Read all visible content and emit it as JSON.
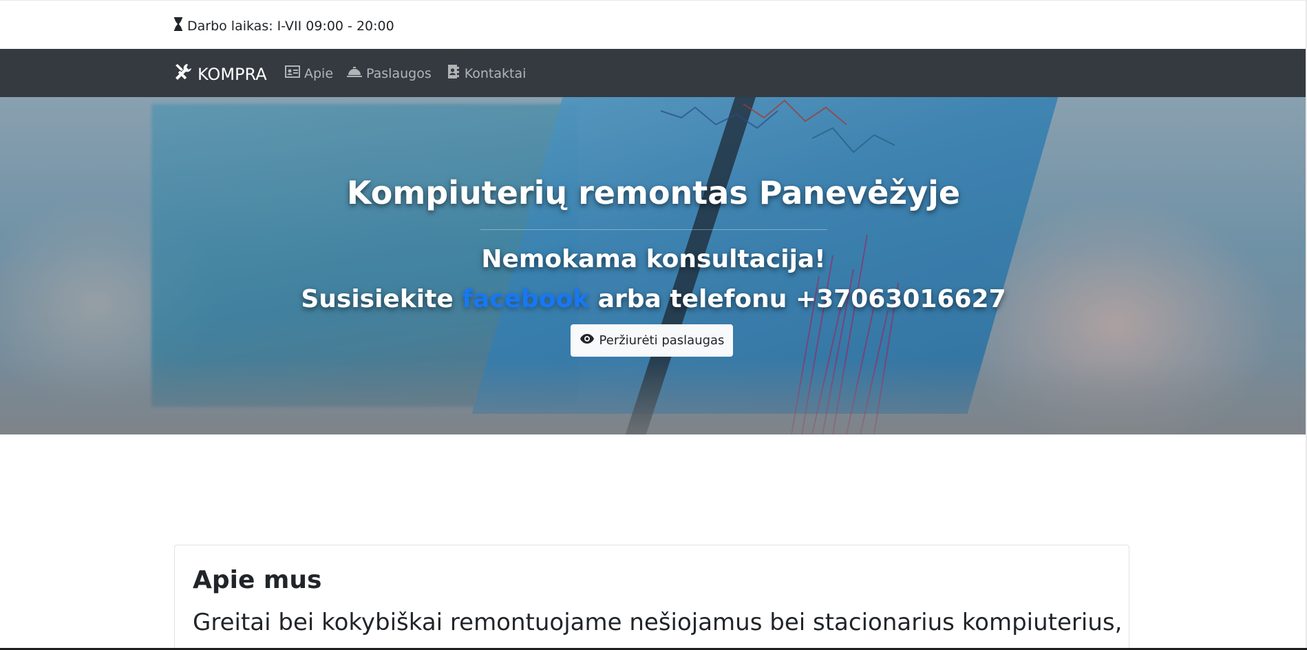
{
  "topbar": {
    "hours_icon": "hourglass-icon",
    "hours_text": "Darbo laikas: I-VII 09:00 - 20:00"
  },
  "navbar": {
    "brand": {
      "icon": "tools-icon",
      "label": "KOMPRA"
    },
    "links": [
      {
        "icon": "id-card-icon",
        "label": "Apie"
      },
      {
        "icon": "concierge-bell-icon",
        "label": "Paslaugos"
      },
      {
        "icon": "address-book-icon",
        "label": "Kontaktai"
      }
    ],
    "background_color": "#343a40"
  },
  "hero": {
    "title": "Kompiuterių remontas Panevėžyje",
    "subtitle": "Nemokama konsultacija!",
    "contact_prefix": "Susisiekite",
    "facebook_link": "facebook",
    "contact_suffix": "arba telefonu +37063016627",
    "button_icon": "eye-icon",
    "button_label": "Peržiurėti paslaugas",
    "facebook_color": "#1877f2"
  },
  "about": {
    "title": "Apie mus",
    "text": "Greitai bei kokybiškai remontuojame nešiojamus bei stacionarius kompiuterius,"
  }
}
